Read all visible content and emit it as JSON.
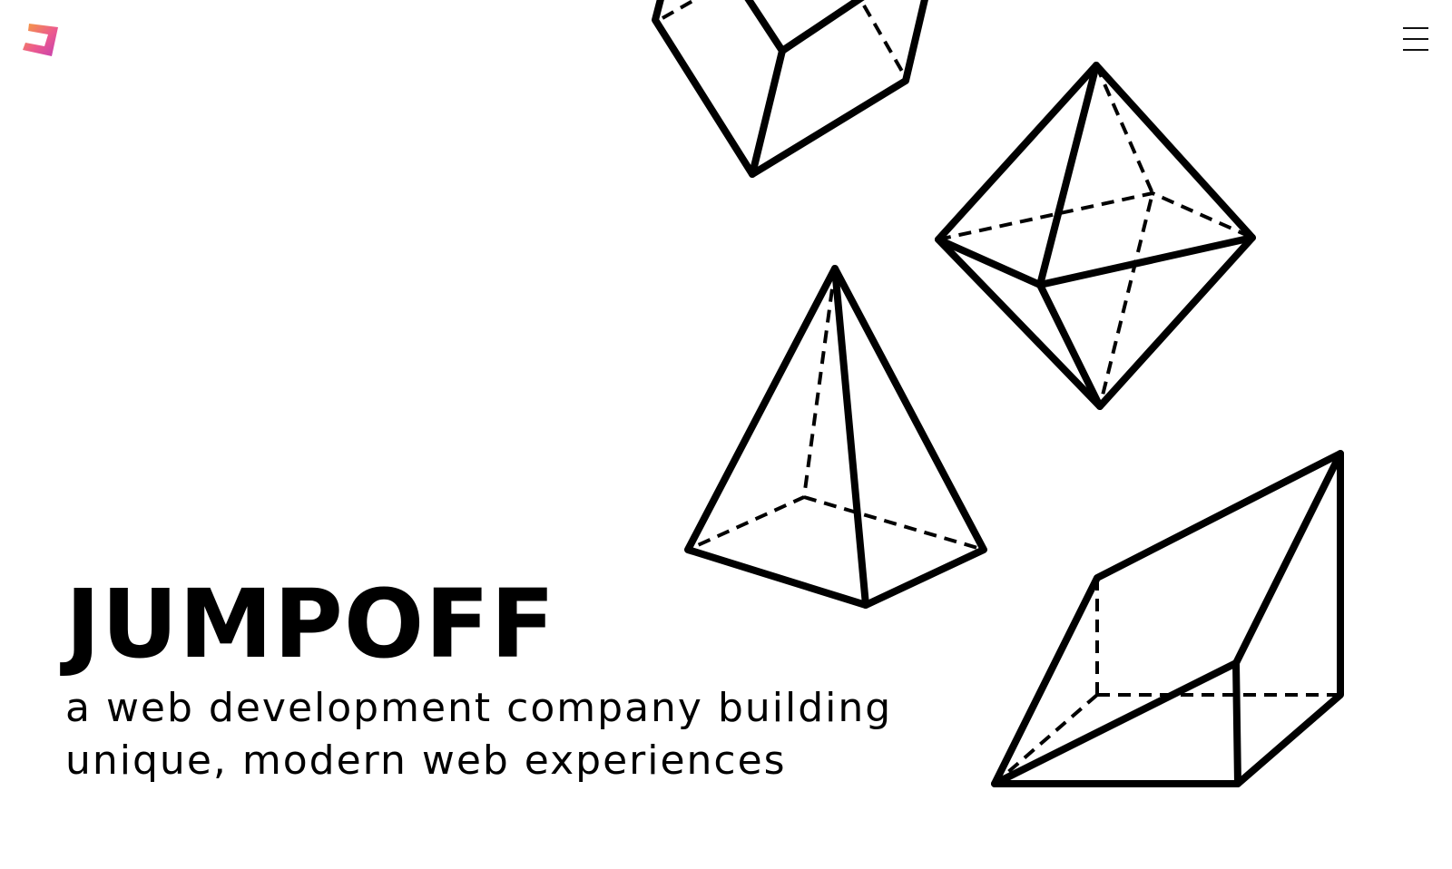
{
  "brand": {
    "logo_icon": "jumpoff-logo-icon",
    "logo_colors": [
      "#f6a03a",
      "#ec5a8e",
      "#c33fb2"
    ],
    "name": "JUMPOFF",
    "tagline": "a web development company building unique, modern web experiences"
  },
  "nav": {
    "menu_icon": "hamburger-menu-icon"
  },
  "illustrations": [
    "cube-icon",
    "octahedron-icon",
    "pyramid-icon",
    "prism-icon"
  ]
}
